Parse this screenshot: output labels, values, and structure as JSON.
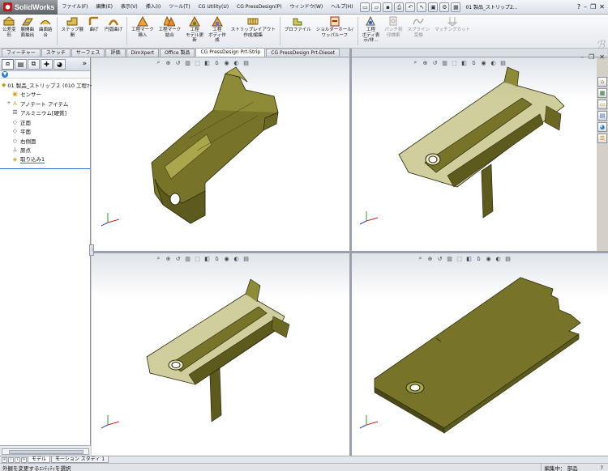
{
  "app": {
    "logo_text": "SolidWorks",
    "menus": [
      "ファイル(F)",
      "編集(E)",
      "表示(V)",
      "挿入(I)",
      "ツール(T)",
      "CG Utility(U)",
      "CG PressDesign(P)",
      "ウィンドウ(W)",
      "ヘルプ(H)"
    ],
    "doc_title": "01 製品_ストリップ2...",
    "help_glyph": "?"
  },
  "commands": [
    {
      "label": "公差変\n形",
      "dis": false
    },
    {
      "label": "展開曲\n面抽出",
      "dis": false
    },
    {
      "label": "曲面結\n合",
      "dis": false
    },
    {
      "label": "ステップ展\n開",
      "dis": false
    },
    {
      "label": "曲げ",
      "dis": false
    },
    {
      "label": "円弧曲げ",
      "dis": false
    },
    {
      "label": "工程マーク\n挿入",
      "dis": false
    },
    {
      "label": "工程マーク\n結合",
      "dis": false
    },
    {
      "label": "工程\nモデル更\n新",
      "dis": false
    },
    {
      "label": "工程\nボディ作\n成",
      "dis": false
    },
    {
      "label": "ストリップレイアウト\n作成/編集",
      "dis": false
    },
    {
      "label": "プロファイル",
      "dis": false
    },
    {
      "label": "ショルダーホール/\nワッパルーフ",
      "dis": false
    },
    {
      "label": "工程\nボディ表\n示/非...",
      "dis": false
    },
    {
      "label": "パンチ刻\n印検索",
      "dis": true
    },
    {
      "label": "スプライン\n変換",
      "dis": true
    },
    {
      "label": "マッチングカット",
      "dis": true
    }
  ],
  "tabs": [
    {
      "label": "フィーチャー",
      "active": false
    },
    {
      "label": "スケッチ",
      "active": false
    },
    {
      "label": "サーフェス",
      "active": false
    },
    {
      "label": "評価",
      "active": false
    },
    {
      "label": "DimXpert",
      "active": false
    },
    {
      "label": "Office 製品",
      "active": false
    },
    {
      "label": "CG PressDesign Prt-Strip",
      "active": true
    },
    {
      "label": "CG PressDesign Prt-Dieset",
      "active": false
    }
  ],
  "tree": {
    "root": "01 製品_ストリップ２ (010 工程ﾏｰ",
    "items": [
      {
        "label": "センサー",
        "icon": "sensor-icon",
        "exp": ""
      },
      {
        "label": "アノテート アイテム",
        "icon": "annotation-icon",
        "exp": "+"
      },
      {
        "label": "アルミニウム[硬質]",
        "icon": "material-icon",
        "exp": ""
      },
      {
        "label": "正面",
        "icon": "plane-icon",
        "exp": ""
      },
      {
        "label": "平面",
        "icon": "plane-icon",
        "exp": ""
      },
      {
        "label": "右側面",
        "icon": "plane-icon",
        "exp": ""
      },
      {
        "label": "原点",
        "icon": "origin-icon",
        "exp": ""
      },
      {
        "label": "取り込み1",
        "icon": "import-icon",
        "exp": ""
      }
    ]
  },
  "bottom_tabs": [
    {
      "label": "モデル",
      "active": true
    },
    {
      "label": "モーション スタディ 1",
      "active": false
    }
  ],
  "status": {
    "left": "外観を変更するｴﾝﾃｨﾃｨを選択",
    "mode": "編集中： 部品",
    "help": "?"
  },
  "colors": {
    "part_fill": "#77742a",
    "part_light": "#a9a64c",
    "part_dark": "#3f3d12",
    "part_edge": "#2c2b0a"
  },
  "triad": {
    "x": "X",
    "y": "Y",
    "z": "Z"
  }
}
